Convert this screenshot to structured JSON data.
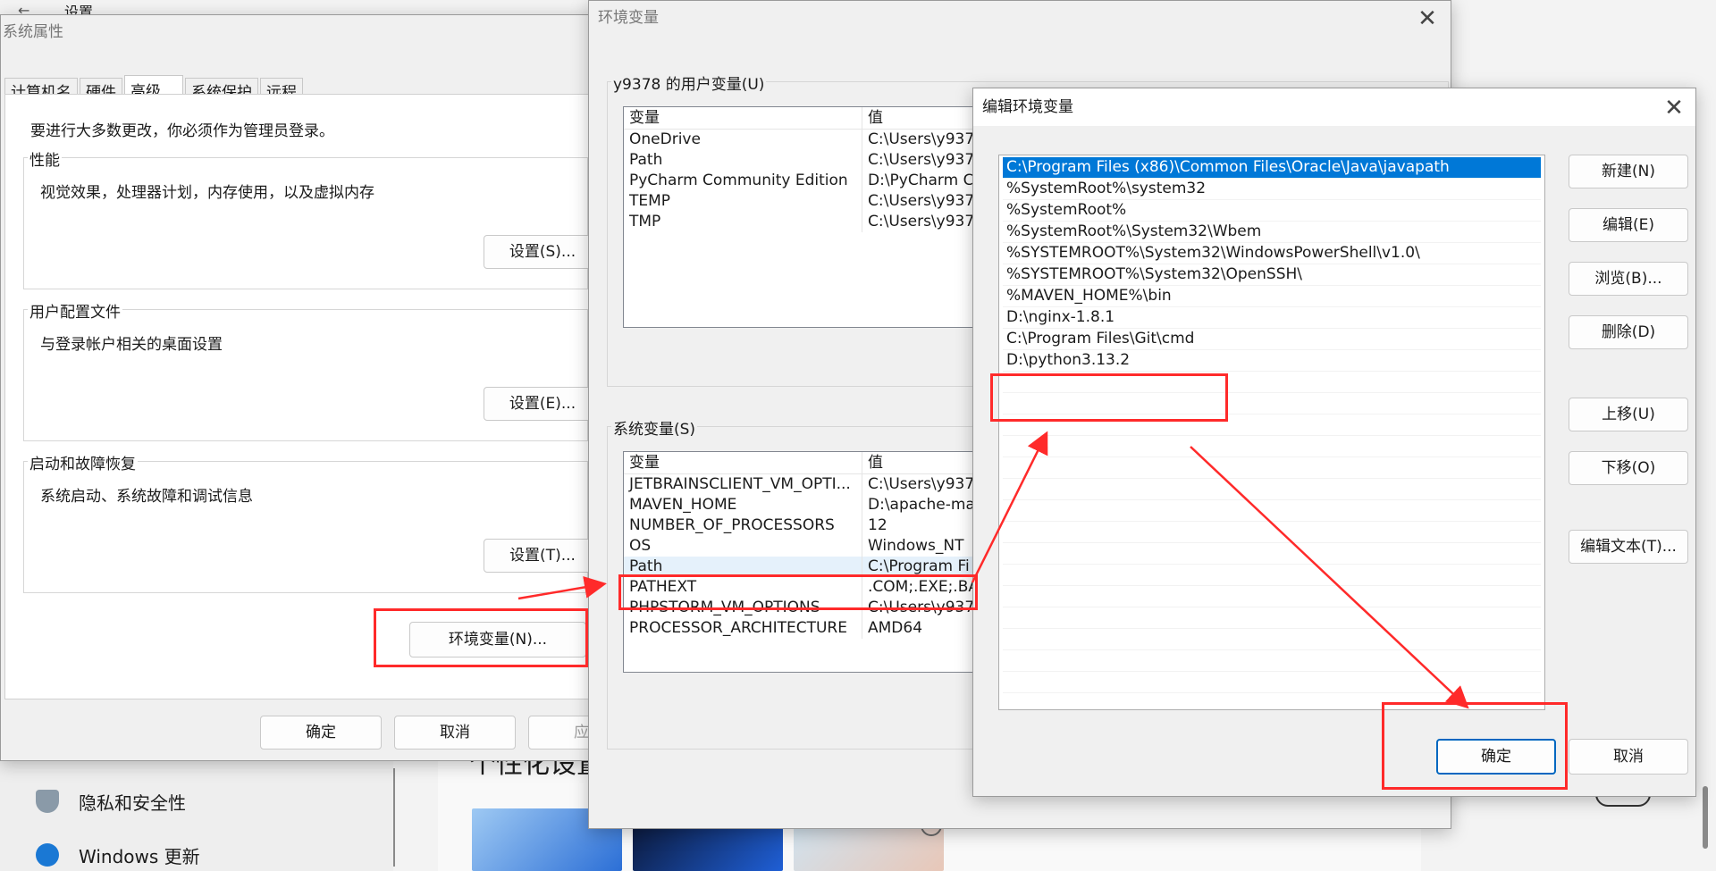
{
  "settings_window": {
    "title": "设置",
    "nav": [
      {
        "label": "隐私和安全性",
        "icon": "shield-icon"
      },
      {
        "label": "Windows 更新",
        "icon": "windows-update-icon"
      }
    ],
    "heading_partial": "个性化设置"
  },
  "sysprops": {
    "title": "系统属性",
    "tabs": [
      "计算机名",
      "硬件",
      "高级",
      "系统保护",
      "远程"
    ],
    "active_tab": "高级",
    "admin_note": "要进行大多数更改，你必须作为管理员登录。",
    "groups": [
      {
        "label": "性能",
        "desc": "视觉效果，处理器计划，内存使用，以及虚拟内存",
        "button": "设置(S)..."
      },
      {
        "label": "用户配置文件",
        "desc": "与登录帐户相关的桌面设置",
        "button": "设置(E)..."
      },
      {
        "label": "启动和故障恢复",
        "desc": "系统启动、系统故障和调试信息",
        "button": "设置(T)..."
      }
    ],
    "env_button": "环境变量(N)...",
    "ok": "确定",
    "cancel": "取消",
    "apply": "应用"
  },
  "envvars": {
    "title": "环境变量",
    "user_group_label": "y9378 的用户变量(U)",
    "col_var": "变量",
    "col_val": "值",
    "user_vars": [
      {
        "name": "OneDrive",
        "value": "C:\\Users\\y937"
      },
      {
        "name": "Path",
        "value": "C:\\Users\\y937"
      },
      {
        "name": "PyCharm Community Edition",
        "value": "D:\\PyCharm C"
      },
      {
        "name": "TEMP",
        "value": "C:\\Users\\y937"
      },
      {
        "name": "TMP",
        "value": "C:\\Users\\y937"
      }
    ],
    "sys_group_label": "系统变量(S)",
    "sys_vars": [
      {
        "name": "JETBRAINSCLIENT_VM_OPTI...",
        "value": "C:\\Users\\y937"
      },
      {
        "name": "MAVEN_HOME",
        "value": "D:\\apache-ma"
      },
      {
        "name": "NUMBER_OF_PROCESSORS",
        "value": "12"
      },
      {
        "name": "OS",
        "value": "Windows_NT"
      },
      {
        "name": "Path",
        "value": "C:\\Program Fi"
      },
      {
        "name": "PATHEXT",
        "value": ".COM;.EXE;.BA"
      },
      {
        "name": "PHPSTORM_VM_OPTIONS",
        "value": "C:\\Users\\y937"
      },
      {
        "name": "PROCESSOR_ARCHITECTURE",
        "value": "AMD64"
      }
    ]
  },
  "editenv": {
    "title": "编辑环境变量",
    "paths": [
      "C:\\Program Files (x86)\\Common Files\\Oracle\\Java\\javapath",
      "%SystemRoot%\\system32",
      "%SystemRoot%",
      "%SystemRoot%\\System32\\Wbem",
      "%SYSTEMROOT%\\System32\\WindowsPowerShell\\v1.0\\",
      "%SYSTEMROOT%\\System32\\OpenSSH\\",
      "%MAVEN_HOME%\\bin",
      "D:\\nginx-1.8.1",
      "C:\\Program Files\\Git\\cmd",
      "D:\\python3.13.2"
    ],
    "buttons": {
      "new": "新建(N)",
      "edit": "编辑(E)",
      "browse": "浏览(B)...",
      "delete": "删除(D)",
      "up": "上移(U)",
      "down": "下移(O)",
      "edit_text": "编辑文本(T)...",
      "ok": "确定",
      "cancel": "取消"
    }
  },
  "colors": {
    "highlight": "#ff2a2a",
    "selection": "#0078d7",
    "accent": "#0067c0"
  }
}
